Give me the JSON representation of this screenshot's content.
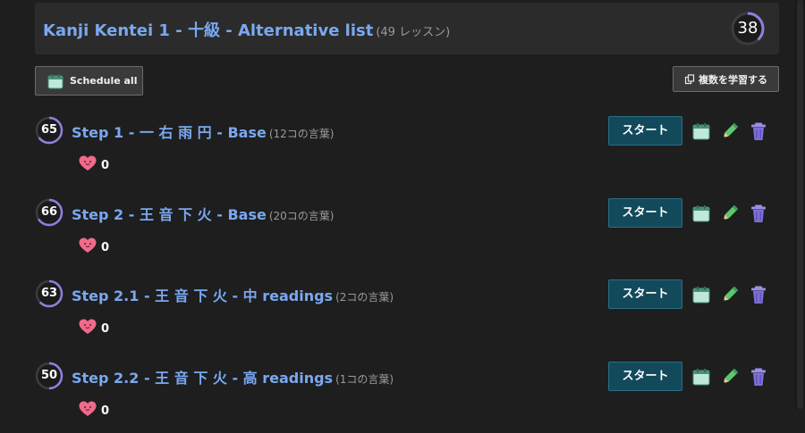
{
  "header": {
    "title": "Kanji Kentei 1 - 十級 - Alternative list",
    "count_text": "(49 レッスン)",
    "progress": 38,
    "ring_color": "#8f7fe0"
  },
  "toolbar": {
    "schedule_all_label": "Schedule all",
    "multi_study_label": "複数を学習する"
  },
  "icons": {
    "calendar": "calendar-icon",
    "edit": "pencil-icon",
    "delete": "trash-icon",
    "heart": "heart-icon",
    "copy": "copy-icon"
  },
  "colors": {
    "link": "#7aa8f0",
    "start_button": "#124a5c",
    "pencil": "#5ec76e",
    "trash": "#7d6fd8",
    "heart": "#f06a8a"
  },
  "lessons": [
    {
      "progress": 65,
      "title": "Step 1 - 一 右 雨 円 - Base",
      "count": "(12コの言葉)",
      "likes": "0",
      "start_label": "スタート"
    },
    {
      "progress": 66,
      "title": "Step 2 - 王 音 下 火 - Base",
      "count": "(20コの言葉)",
      "likes": "0",
      "start_label": "スタート"
    },
    {
      "progress": 63,
      "title": "Step 2.1 - 王 音 下 火 - 中 readings",
      "count": "(2コの言葉)",
      "likes": "0",
      "start_label": "スタート"
    },
    {
      "progress": 50,
      "title": "Step 2.2 - 王 音 下 火 - 高 readings",
      "count": "(1コの言葉)",
      "likes": "0",
      "start_label": "スタート"
    }
  ]
}
